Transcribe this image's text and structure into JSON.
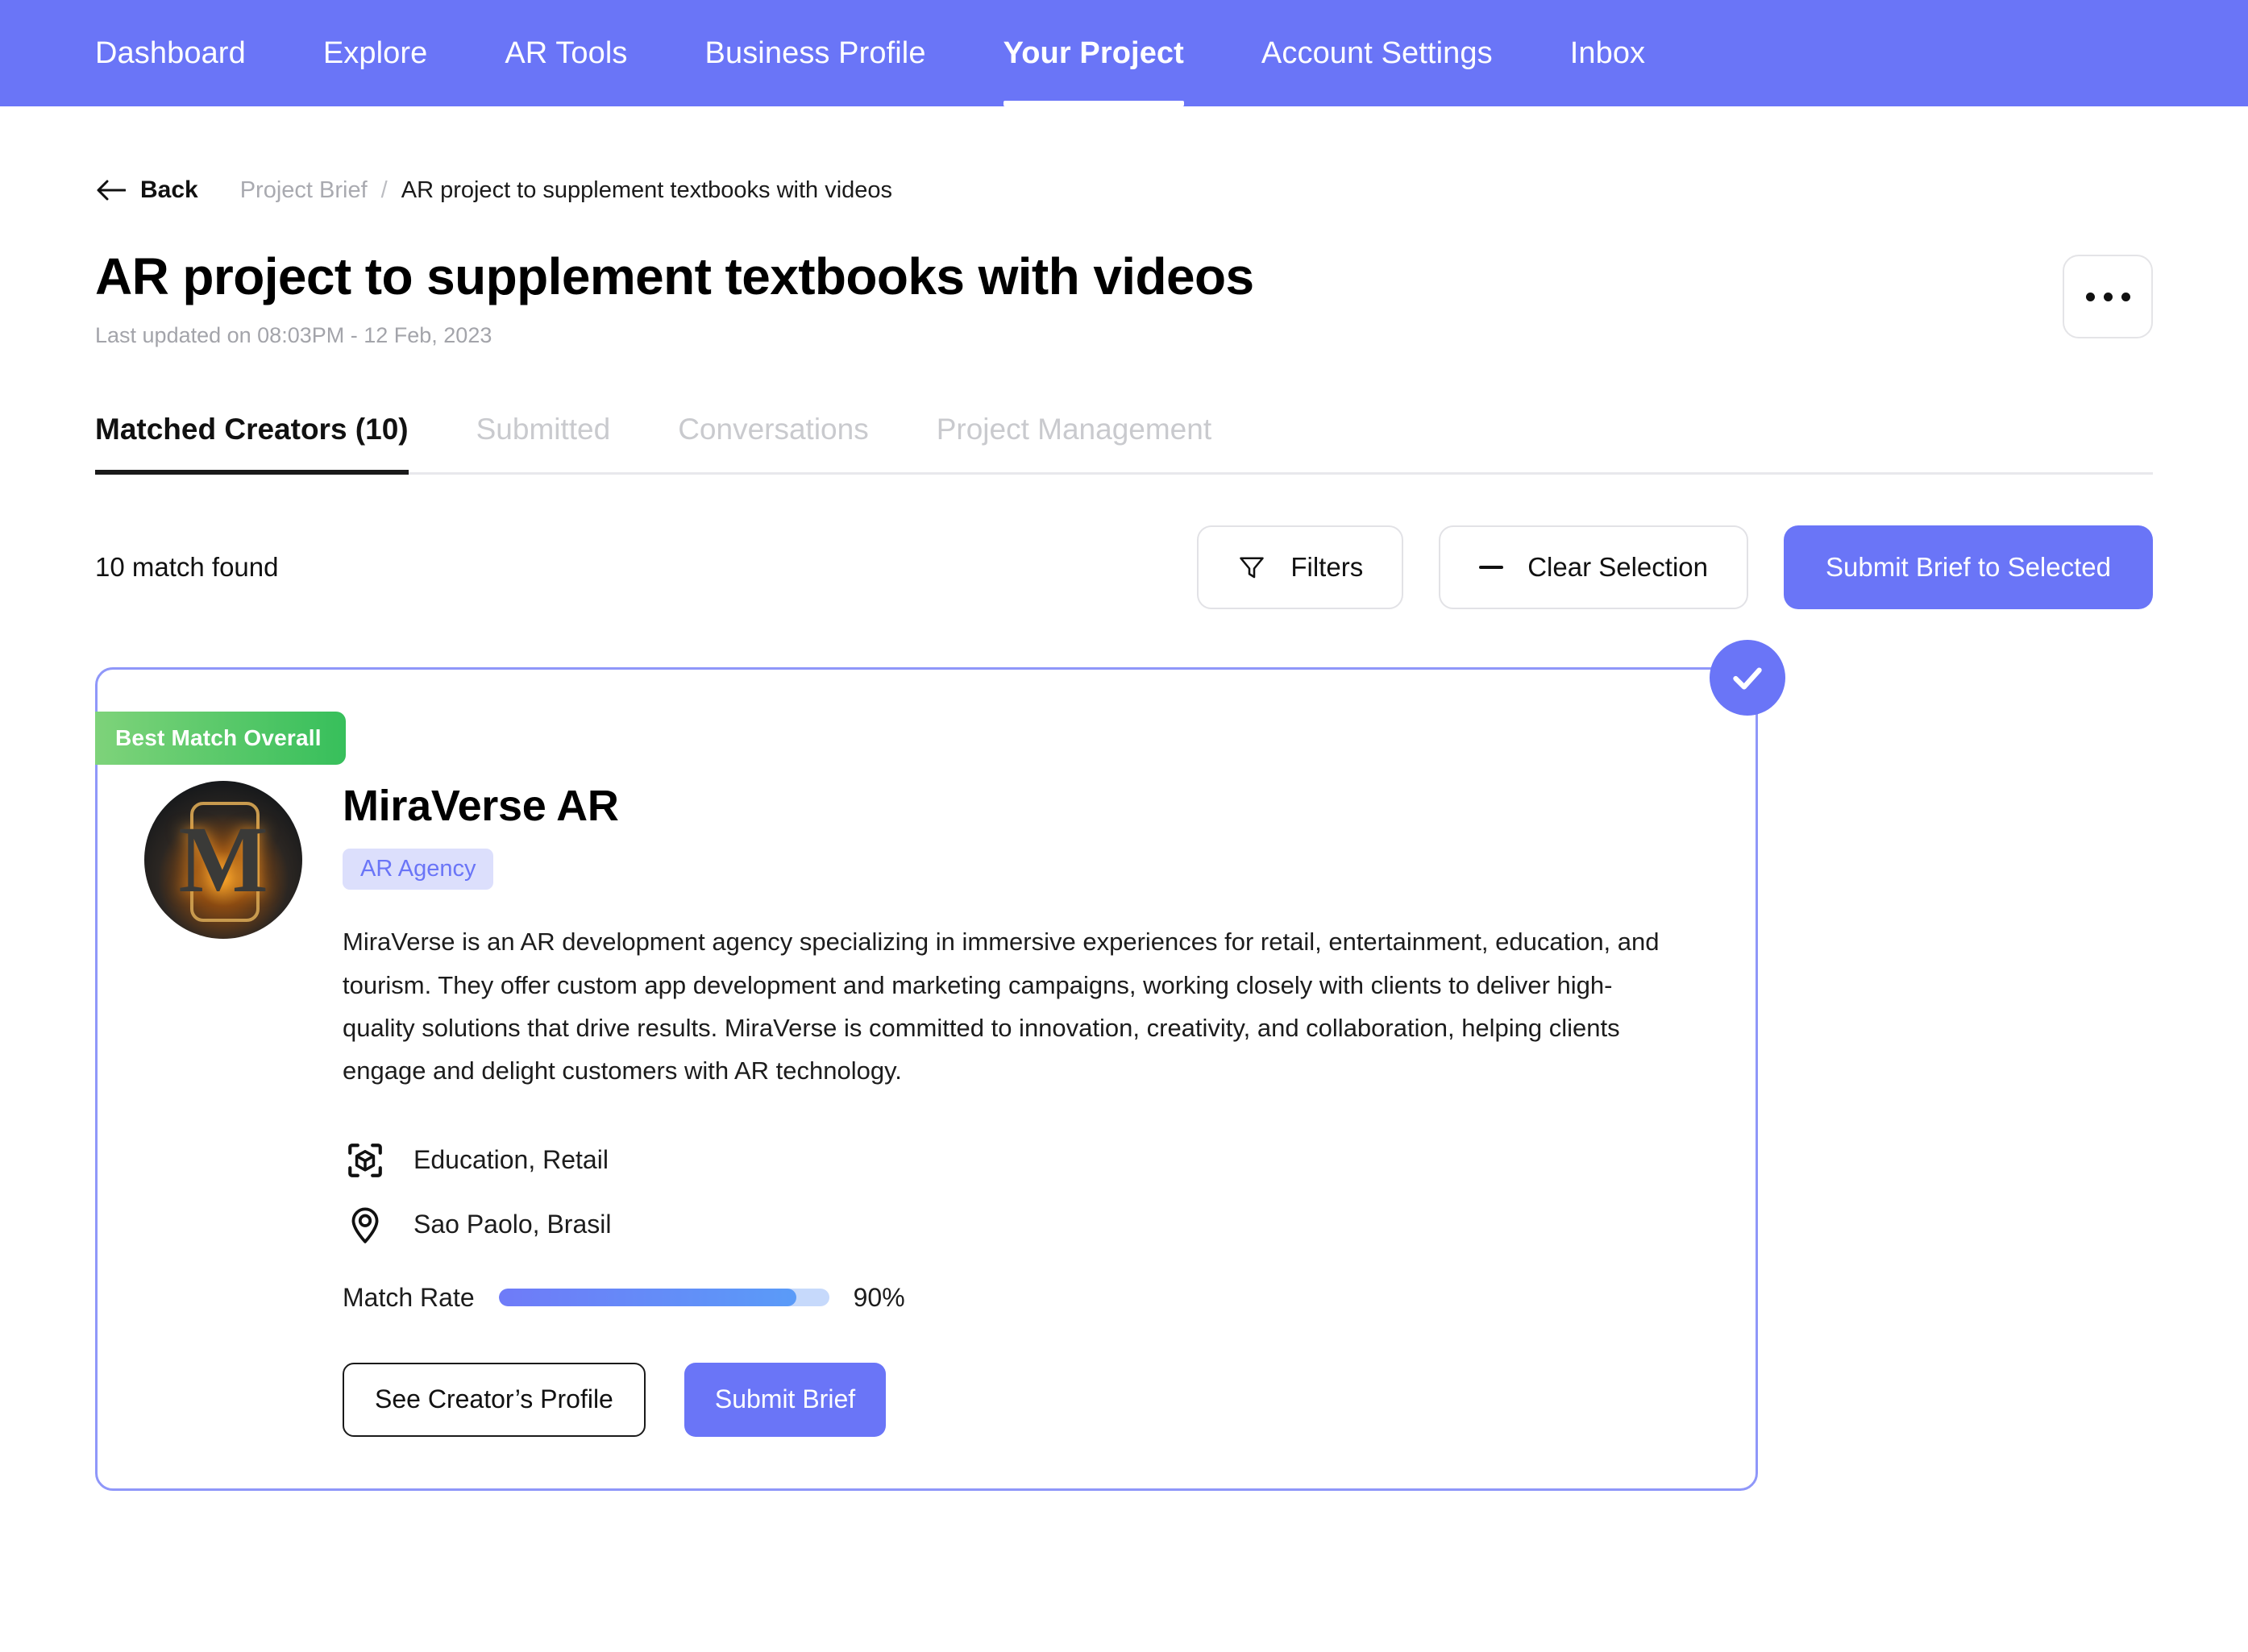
{
  "nav": {
    "items": [
      {
        "label": "Dashboard",
        "active": false
      },
      {
        "label": "Explore",
        "active": false
      },
      {
        "label": "AR Tools",
        "active": false
      },
      {
        "label": "Business Profile",
        "active": false
      },
      {
        "label": "Your Project",
        "active": true
      },
      {
        "label": "Account Settings",
        "active": false
      },
      {
        "label": "Inbox",
        "active": false
      }
    ]
  },
  "breadcrumb": {
    "back_label": "Back",
    "parent": "Project Brief",
    "separator": "/",
    "current": "AR project to supplement textbooks with videos"
  },
  "header": {
    "title": "AR project to supplement textbooks with videos",
    "subtitle": "Last updated on 08:03PM - 12 Feb, 2023"
  },
  "tabs": [
    {
      "label": "Matched Creators (10)",
      "active": true
    },
    {
      "label": "Submitted",
      "active": false
    },
    {
      "label": "Conversations",
      "active": false
    },
    {
      "label": "Project Management",
      "active": false
    }
  ],
  "actionbar": {
    "match_count": "10 match found",
    "filters_label": "Filters",
    "clear_label": "Clear Selection",
    "submit_label": "Submit Brief to Selected"
  },
  "card": {
    "badge": "Best Match Overall",
    "avatar_letter": "M",
    "name": "MiraVerse AR",
    "tag": "AR Agency",
    "description": "MiraVerse is an AR development agency specializing in immersive experiences for retail, entertainment, education, and tourism. They offer custom app development and marketing campaigns, working closely with clients to deliver high-quality solutions that drive results. MiraVerse is committed to innovation, creativity, and collaboration, helping clients engage and delight customers with AR technology.",
    "industries": "Education, Retail",
    "location": "Sao Paolo, Brasil",
    "match_label": "Match Rate",
    "match_value": "90%",
    "match_percent": 90,
    "profile_btn": "See Creator’s Profile",
    "submit_btn": "Submit Brief",
    "selected": true
  },
  "colors": {
    "brand": "#6a75f7",
    "badge_green_start": "#7ed37a",
    "badge_green_end": "#37bf5b",
    "tag_bg": "#dcdffc"
  }
}
